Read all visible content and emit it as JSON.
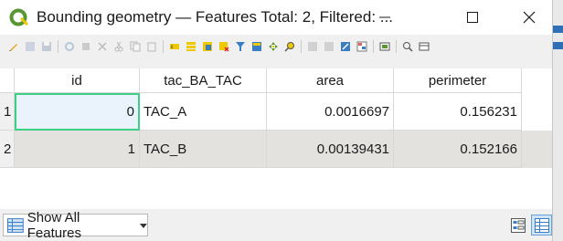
{
  "window": {
    "title": "Bounding geometry — Features Total: 2, Filtered: ...",
    "controls": {
      "minimize": "—",
      "maximize": "☐",
      "close": "✕"
    }
  },
  "toolbar": {
    "icons": [
      "toggle-editing-icon",
      "multi-edit-icon",
      "save-edits-icon",
      "reload-icon",
      "add-feature-icon",
      "delete-feature-icon",
      "cut-icon",
      "copy-icon",
      "paste-icon",
      "expression-select-icon",
      "select-all-icon",
      "invert-selection-icon",
      "deselect-icon",
      "filter-icon",
      "move-selection-top-icon",
      "pan-to-selection-icon",
      "zoom-to-selection-icon",
      "new-field-icon",
      "delete-field-icon",
      "field-calculator-icon",
      "conditional-formatting-icon",
      "actions-icon",
      "dock-icon",
      "organize-columns-icon"
    ]
  },
  "table": {
    "columns": [
      "id",
      "tac_BA_TAC",
      "area",
      "perimeter"
    ],
    "rows": [
      {
        "num": "1",
        "id": "0",
        "tac": "TAC_A",
        "area": "0.0016697",
        "perimeter": "0.156231"
      },
      {
        "num": "2",
        "id": "1",
        "tac": "TAC_B",
        "area": "0.00139431",
        "perimeter": "0.152166"
      }
    ]
  },
  "bottom": {
    "show_features": "Show All Features",
    "views": [
      "form-view-icon",
      "table-view-icon"
    ]
  },
  "colors": {
    "selection_border": "#3ecf86",
    "alt_row": "#e4e2de",
    "qgis_green": "#589632",
    "qgis_yellow": "#eec900"
  }
}
